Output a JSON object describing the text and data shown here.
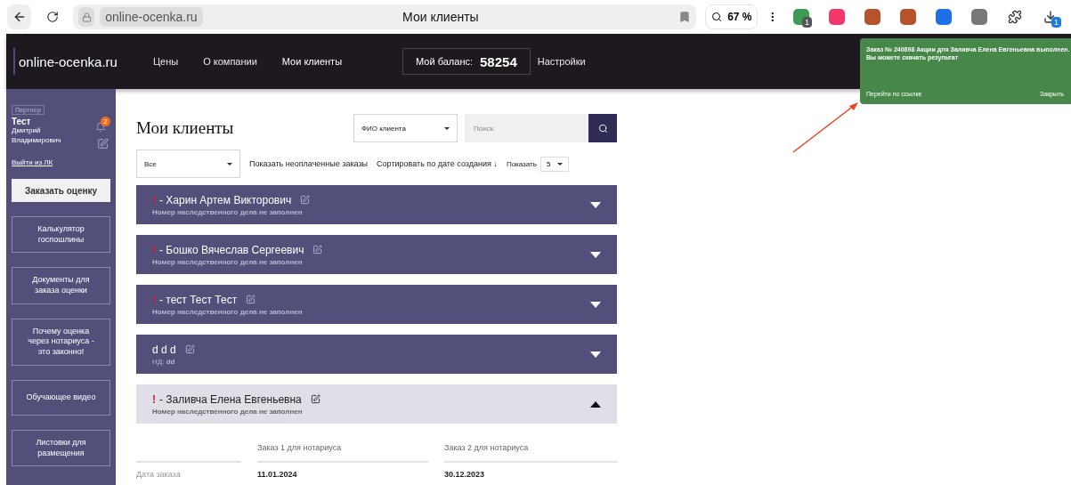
{
  "browser": {
    "url": "online-ocenka.ru",
    "title": "Мои клиенты",
    "zoom": "67 %",
    "extensions": [
      {
        "kind": "shield",
        "badge": "1"
      },
      {
        "kind": "pink"
      },
      {
        "kind": "stamp"
      },
      {
        "kind": "stamp"
      },
      {
        "kind": "y"
      },
      {
        "kind": "tray"
      },
      {
        "kind": "puzzle"
      },
      {
        "kind": "download",
        "badge": "1"
      }
    ]
  },
  "header": {
    "logo": "online-ocenka.ru",
    "nav": [
      {
        "label": "Цены",
        "selected": false
      },
      {
        "label": "О компании",
        "selected": false
      },
      {
        "label": "Мои клиенты",
        "selected": true
      }
    ],
    "balance_label": "Мой баланс:",
    "balance": "58254",
    "settings": "Настройки"
  },
  "toast": {
    "message": "Заказ № 240898 Акции для Заливча Елена Евгеньевна выполнен. Вы можете скачать результат",
    "link": "Перейти по ссылке",
    "close": "Закрыть"
  },
  "sidebar": {
    "role": "Партнер",
    "name": "Тест",
    "patronymic": "Дмитрий Владимирович",
    "notifications": "2",
    "logout": "Выйти из ЛК",
    "order_button": "Заказать оценку",
    "items": [
      "Калькулятор госпошлины",
      "Документы для заказа оценки",
      "Почему оценка через нотариуса - это законно!",
      "Обучающее видео",
      "Листовки для размещения"
    ]
  },
  "main": {
    "title": "Мои клиенты",
    "search_by": "ФИО клиента",
    "search": {
      "placeholder": "Поиск"
    },
    "filter": "Все",
    "unpaid": "Показать неоплаченные заказы",
    "sort": "Сортировать по дате создания ↓",
    "show_label": "Показать",
    "show_count": "5"
  },
  "clients": [
    {
      "mark": "!",
      "name": "- Харин Артем Викторович",
      "warning": true,
      "note": "Номер наследственного дела не заполнен",
      "expanded": false
    },
    {
      "mark": "!",
      "name": "- Бошко Вячеслав Сергеевич",
      "warning": true,
      "note": "Номер наследственного дела не заполнен",
      "expanded": false
    },
    {
      "mark": "!",
      "name": "- тест Тест Тест",
      "warning": true,
      "note": "Номер наследственного дела не заполнен",
      "expanded": false
    },
    {
      "name": "d d d",
      "warning": false,
      "note": "НД: **dd**",
      "expanded": false
    },
    {
      "mark": "!",
      "name": "- Заливча Елена Евгеньевна",
      "warning": true,
      "note": "Номер наследственного дела не заполнен",
      "expanded": true
    }
  ],
  "orders": {
    "columns": [
      "Заказ 1 для нотариуса",
      "Заказ 2 для нотариуса"
    ],
    "rows": [
      {
        "label": "Дата заказа",
        "values": [
          "11.01.2024",
          "30.12.2023"
        ]
      }
    ]
  },
  "annotation": {
    "kind": "arrow"
  }
}
